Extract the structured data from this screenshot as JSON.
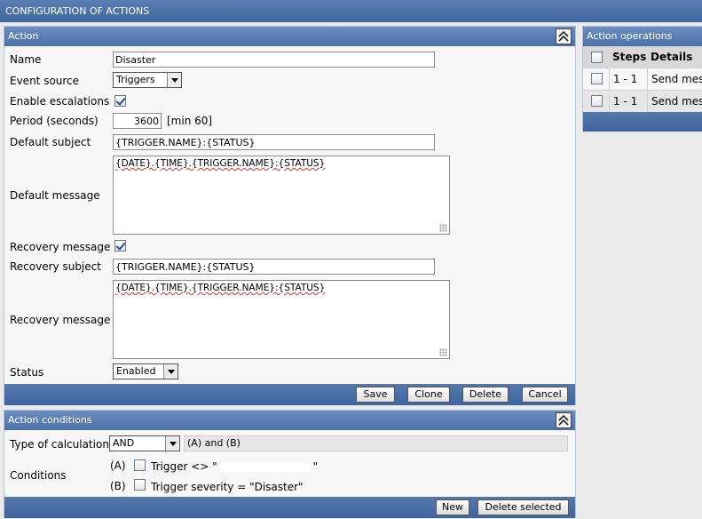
{
  "window": {
    "title": "CONFIGURATION OF ACTIONS"
  },
  "action": {
    "header": "Action",
    "name_label": "Name",
    "name_value": "Disaster",
    "event_source_label": "Event source",
    "event_source_value": "Triggers",
    "enable_escalations_label": "Enable escalations",
    "enable_escalations_checked": true,
    "period_label": "Period (seconds)",
    "period_value": "3600",
    "period_hint": "[min 60]",
    "default_subject_label": "Default subject",
    "default_subject_value": "{TRIGGER.NAME}:{STATUS}",
    "default_message_label": "Default message",
    "default_message_value": "{DATE}.{TIME}.{TRIGGER.NAME}:{STATUS}",
    "recovery_message_check_label": "Recovery message",
    "recovery_message_checked": true,
    "recovery_subject_label": "Recovery subject",
    "recovery_subject_value": "{TRIGGER.NAME}:{STATUS}",
    "recovery_message_label": "Recovery message",
    "recovery_message_value": "{DATE}.{TIME}.{TRIGGER.NAME}:{STATUS}",
    "status_label": "Status",
    "status_value": "Enabled",
    "buttons": {
      "save": "Save",
      "clone": "Clone",
      "delete": "Delete",
      "cancel": "Cancel"
    }
  },
  "conditions": {
    "header": "Action conditions",
    "calc_label": "Type of calculation",
    "calc_value": "AND",
    "calc_formula": "(A) and (B)",
    "conditions_label": "Conditions",
    "items": [
      {
        "tag": "(A)",
        "text_before": "Trigger <> \"",
        "text_after": "\""
      },
      {
        "tag": "(B)",
        "text": "Trigger severity = \"Disaster\""
      }
    ],
    "buttons": {
      "new": "New",
      "delete_selected": "Delete selected"
    }
  },
  "operations": {
    "header": "Action operations",
    "columns": {
      "steps": "Steps",
      "details": "Details"
    },
    "rows": [
      {
        "steps": "1 - 1",
        "details": "Send mes"
      },
      {
        "steps": "1 - 1",
        "details": "Send mes"
      }
    ]
  }
}
